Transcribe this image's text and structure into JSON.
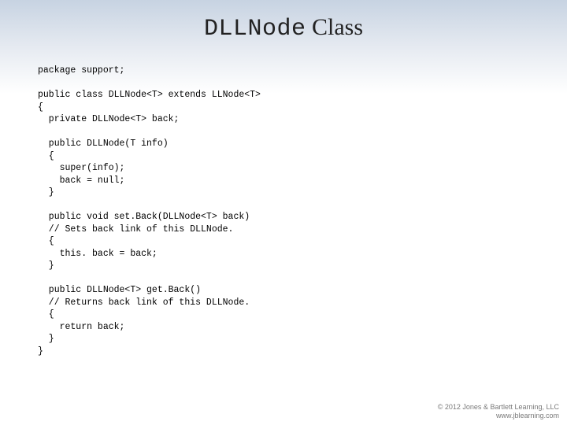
{
  "title": {
    "mono": "DLLNode",
    "serif": " Class"
  },
  "code": "package support;\n\npublic class DLLNode<T> extends LLNode<T>\n{\n  private DLLNode<T> back;\n\n  public DLLNode(T info)\n  {\n    super(info);\n    back = null;\n  }\n\n  public void set.Back(DLLNode<T> back)\n  // Sets back link of this DLLNode.\n  {\n    this. back = back;\n  }\n\n  public DLLNode<T> get.Back()\n  // Returns back link of this DLLNode.\n  {\n    return back;\n  }\n}",
  "footer": {
    "line1": "© 2012 Jones & Bartlett Learning, LLC",
    "line2": "www.jblearning.com"
  }
}
